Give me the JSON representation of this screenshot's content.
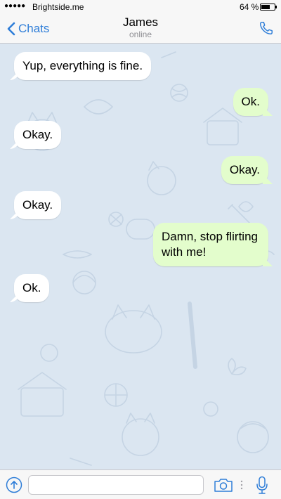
{
  "status_bar": {
    "signal": "●●●●●",
    "carrier": "Brightside.me",
    "battery_text": "64 %",
    "battery_level": 0.64
  },
  "header": {
    "back_label": "Chats",
    "title": "James",
    "subtitle": "online"
  },
  "messages": [
    {
      "direction": "in",
      "text": "Yup, everything is fine."
    },
    {
      "direction": "out",
      "text": "Ok."
    },
    {
      "direction": "in",
      "text": "Okay."
    },
    {
      "direction": "out",
      "text": "Okay."
    },
    {
      "direction": "in",
      "text": "Okay."
    },
    {
      "direction": "out",
      "text": "Damn, stop flirting with me!"
    },
    {
      "direction": "in",
      "text": "Ok."
    }
  ],
  "input": {
    "placeholder": ""
  },
  "colors": {
    "accent": "#2f7ed8",
    "chat_background": "#dbe6f1",
    "incoming_bubble": "#ffffff",
    "outgoing_bubble": "#e3fdcc"
  },
  "icons": {
    "back": "chevron-left-icon",
    "call": "phone-icon",
    "attach": "attach-arrow-icon",
    "camera": "camera-icon",
    "mic": "microphone-icon"
  }
}
